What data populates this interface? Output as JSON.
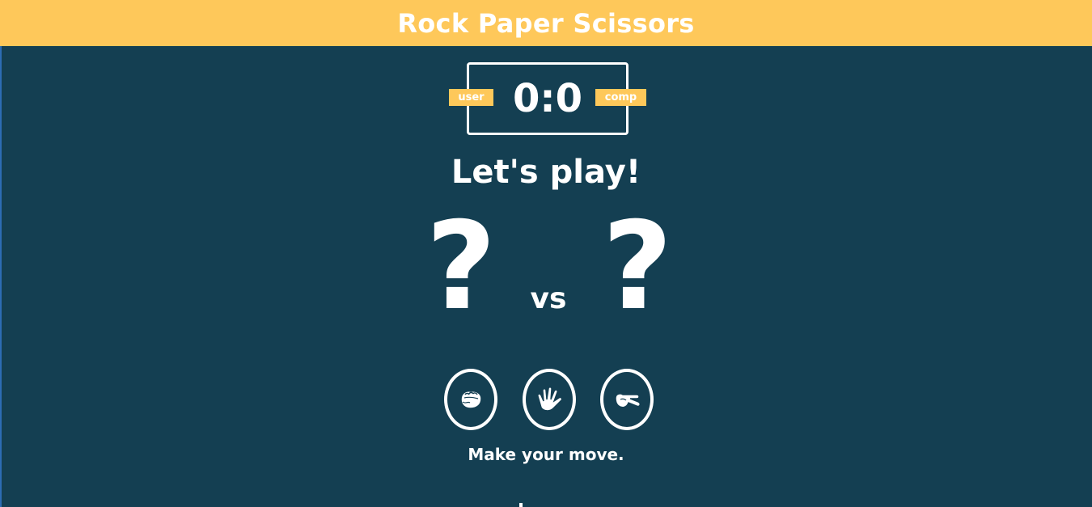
{
  "header": {
    "title": "Rock Paper Scissors"
  },
  "scoreboard": {
    "user_label": "user",
    "comp_label": "comp",
    "score": "0:0"
  },
  "result": {
    "message": "Let's play!",
    "user_choice": "?",
    "vs_label": "vs",
    "comp_choice": "?"
  },
  "choices": [
    {
      "id": "rock",
      "icon": "rock-hand-icon"
    },
    {
      "id": "paper",
      "icon": "paper-hand-icon"
    },
    {
      "id": "scissors",
      "icon": "scissors-hand-icon"
    }
  ],
  "prompt": "Make your move.",
  "colors": {
    "background": "#143f52",
    "accent": "#fec85a",
    "text": "#ffffff"
  }
}
